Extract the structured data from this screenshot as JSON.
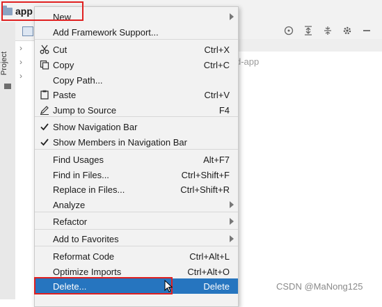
{
  "breadcrumb": {
    "label": "app",
    "icon": "folder-icon"
  },
  "side_tab": {
    "label": "Project"
  },
  "project": {
    "path_fragment": "d-app"
  },
  "toolbar": {
    "icons": [
      "target-icon",
      "expand-icon",
      "collapse-icon",
      "gear-icon",
      "minimize-icon"
    ]
  },
  "menu": {
    "items": [
      {
        "label": "New",
        "shortcut": "",
        "submenu": true,
        "icon": ""
      },
      {
        "label": "Add Framework Support...",
        "shortcut": "",
        "submenu": false,
        "icon": ""
      },
      {
        "label": "Cut",
        "shortcut": "Ctrl+X",
        "submenu": false,
        "icon": "scissors-icon"
      },
      {
        "label": "Copy",
        "shortcut": "Ctrl+C",
        "submenu": false,
        "icon": "copy-icon"
      },
      {
        "label": "Copy Path...",
        "shortcut": "",
        "submenu": false,
        "icon": ""
      },
      {
        "label": "Paste",
        "shortcut": "Ctrl+V",
        "submenu": false,
        "icon": "clipboard-icon"
      },
      {
        "label": "Jump to Source",
        "shortcut": "F4",
        "submenu": false,
        "icon": "pencil-icon"
      },
      {
        "label": "Show Navigation Bar",
        "shortcut": "",
        "submenu": false,
        "icon": "check-icon"
      },
      {
        "label": "Show Members in Navigation Bar",
        "shortcut": "",
        "submenu": false,
        "icon": "check-icon"
      },
      {
        "label": "Find Usages",
        "shortcut": "Alt+F7",
        "submenu": false,
        "icon": ""
      },
      {
        "label": "Find in Files...",
        "shortcut": "Ctrl+Shift+F",
        "submenu": false,
        "icon": ""
      },
      {
        "label": "Replace in Files...",
        "shortcut": "Ctrl+Shift+R",
        "submenu": false,
        "icon": ""
      },
      {
        "label": "Analyze",
        "shortcut": "",
        "submenu": true,
        "icon": ""
      },
      {
        "label": "Refactor",
        "shortcut": "",
        "submenu": true,
        "icon": ""
      },
      {
        "label": "Add to Favorites",
        "shortcut": "",
        "submenu": true,
        "icon": ""
      },
      {
        "label": "Reformat Code",
        "shortcut": "Ctrl+Alt+L",
        "submenu": false,
        "icon": ""
      },
      {
        "label": "Optimize Imports",
        "shortcut": "Ctrl+Alt+O",
        "submenu": false,
        "icon": ""
      },
      {
        "label": "Delete...",
        "shortcut": "Delete",
        "submenu": false,
        "icon": "",
        "selected": true
      }
    ]
  },
  "watermark": "CSDN @MaNong125",
  "colors": {
    "selection": "#2675bf",
    "highlight_box": "#e02020",
    "menu_bg": "#f2f2f2"
  }
}
